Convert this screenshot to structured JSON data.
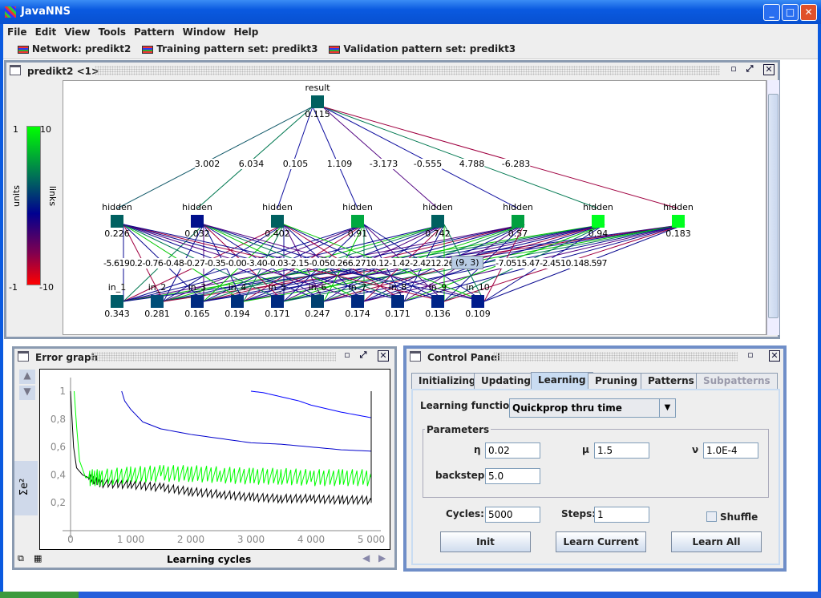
{
  "window": {
    "title": "JavaNNS"
  },
  "menu": [
    "File",
    "Edit",
    "View",
    "Tools",
    "Pattern",
    "Window",
    "Help"
  ],
  "toolbar": {
    "network": "Network: predikt2",
    "training": "Training pattern set: predikt3",
    "validation": "Validation pattern set: predikt3"
  },
  "network_view": {
    "title": "predikt2 <1>",
    "legend": {
      "units_label": "units",
      "links_label": "links",
      "units_max": "1",
      "units_min": "-1",
      "links_max": "10",
      "links_min": "-10",
      "colors": [
        "#00ff00",
        "#006060",
        "#000090",
        "#800050",
        "#ff0000"
      ]
    },
    "output": {
      "label": "result",
      "value": "0.115",
      "color": "#006060"
    },
    "hidden": [
      {
        "label": "hidden",
        "value": "0.226",
        "color": "#006060"
      },
      {
        "label": "hidden",
        "value": "0.032",
        "color": "#00108c"
      },
      {
        "label": "hidden",
        "value": "0.402",
        "color": "#006060"
      },
      {
        "label": "hidden",
        "value": "0.91",
        "color": "#00a840"
      },
      {
        "label": "hidden",
        "value": "0.742",
        "color": "#006060"
      },
      {
        "label": "hidden",
        "value": "0.57",
        "color": "#00a040"
      },
      {
        "label": "hidden",
        "value": "0.94",
        "color": "#00ff20"
      },
      {
        "label": "hidden",
        "value": "0.183",
        "color": "#00ff20"
      }
    ],
    "hidden_output_weights": [
      "3.002",
      "6.034",
      "0.105",
      "1.109",
      "-3.173",
      "-0.555",
      "4.788",
      "-6.283"
    ],
    "inputs": [
      {
        "label": "in_1",
        "value": "0.343",
        "color": "#005c68"
      },
      {
        "label": "in_2",
        "value": "0.281",
        "color": "#004e78"
      },
      {
        "label": "in_3",
        "value": "0.165",
        "color": "#002a80"
      },
      {
        "label": "in_4",
        "value": "0.194",
        "color": "#00307c"
      },
      {
        "label": "in_5",
        "value": "0.171",
        "color": "#002a80"
      },
      {
        "label": "in_6",
        "value": "0.247",
        "color": "#004070"
      },
      {
        "label": "in_7",
        "value": "0.174",
        "color": "#002a80"
      },
      {
        "label": "in_8",
        "value": "0.171",
        "color": "#002a80"
      },
      {
        "label": "in_9",
        "value": "0.136",
        "color": "#002488"
      },
      {
        "label": "in_10",
        "value": "0.109",
        "color": "#001c8c"
      }
    ],
    "input_hidden_weights": [
      "-5.619",
      "0.2",
      "-0.76",
      "-0.48",
      "-0.27",
      "-0.35",
      "-0.00",
      "-3.40",
      "-0.03",
      "-2.15",
      "-0.05",
      "0.26",
      "6.27",
      "10.12",
      "-1.42",
      "-2.42",
      "12.26",
      "-7",
      "-7.05",
      "15.47",
      "-2.45",
      "10.14",
      "8.597"
    ],
    "tooltip": "(9, 3)"
  },
  "error_graph": {
    "title": "Error graph",
    "xlabel": "Learning cycles",
    "ylabel": "Σe²"
  },
  "chart_data": {
    "type": "line",
    "xlabel": "Learning cycles",
    "ylabel": "Σe²",
    "xlim": [
      0,
      5000
    ],
    "ylim": [
      0,
      1
    ],
    "xticks": [
      "0",
      "1 000",
      "2 000",
      "3 000",
      "4 000",
      "5 000"
    ],
    "yticks": [
      "0,2",
      "0,4",
      "0,6",
      "0,8",
      "1"
    ],
    "series": [
      {
        "color": "#000000",
        "x": [
          0,
          50,
          100,
          200,
          500,
          1000,
          1500,
          2000,
          2500,
          3000,
          3500,
          4000,
          4500,
          5000
        ],
        "y": [
          1,
          0.6,
          0.45,
          0.4,
          0.34,
          0.33,
          0.31,
          0.28,
          0.26,
          0.24,
          0.23,
          0.23,
          0.22,
          0.22
        ]
      },
      {
        "color": "#00ff00",
        "x": [
          60,
          100,
          150,
          250,
          500,
          1000,
          1500,
          2000,
          2500,
          3000,
          3500,
          4000,
          4500,
          5000
        ],
        "y": [
          1,
          0.75,
          0.5,
          0.38,
          0.38,
          0.4,
          0.41,
          0.41,
          0.4,
          0.39,
          0.39,
          0.38,
          0.38,
          0.38
        ]
      },
      {
        "color": "#0000cc",
        "x": [
          850,
          900,
          1000,
          1200,
          1500,
          2000,
          2500,
          3000,
          3500,
          4000,
          4500,
          5000
        ],
        "y": [
          1,
          0.93,
          0.87,
          0.78,
          0.73,
          0.69,
          0.66,
          0.63,
          0.62,
          0.6,
          0.58,
          0.57
        ]
      },
      {
        "color": "#0000ff",
        "x": [
          3000,
          3200,
          3500,
          3800,
          4000,
          4500,
          5000
        ],
        "y": [
          1,
          0.99,
          0.96,
          0.93,
          0.9,
          0.85,
          0.81
        ]
      }
    ]
  },
  "control_panel": {
    "title": "Control Panel",
    "tabs": [
      {
        "label": "Initializing"
      },
      {
        "label": "Updating"
      },
      {
        "label": "Learning",
        "selected": true
      },
      {
        "label": "Pruning"
      },
      {
        "label": "Patterns"
      },
      {
        "label": "Subpatterns",
        "disabled": true
      }
    ],
    "learning_function_label": "Learning function:",
    "learning_function": "Quickprop thru time",
    "parameters_title": "Parameters",
    "eta_label": "η",
    "eta": "0.02",
    "mu_label": "μ",
    "mu": "1.5",
    "nu_label": "ν",
    "nu": "1.0E-4",
    "backstep_label": "backstep",
    "backstep": "5.0",
    "cycles_label": "Cycles:",
    "cycles": "5000",
    "steps_label": "Steps:",
    "steps": "1",
    "shuffle_label": "Shuffle",
    "shuffle": false,
    "init": "Init",
    "learn_current": "Learn Current",
    "learn_all": "Learn All"
  }
}
